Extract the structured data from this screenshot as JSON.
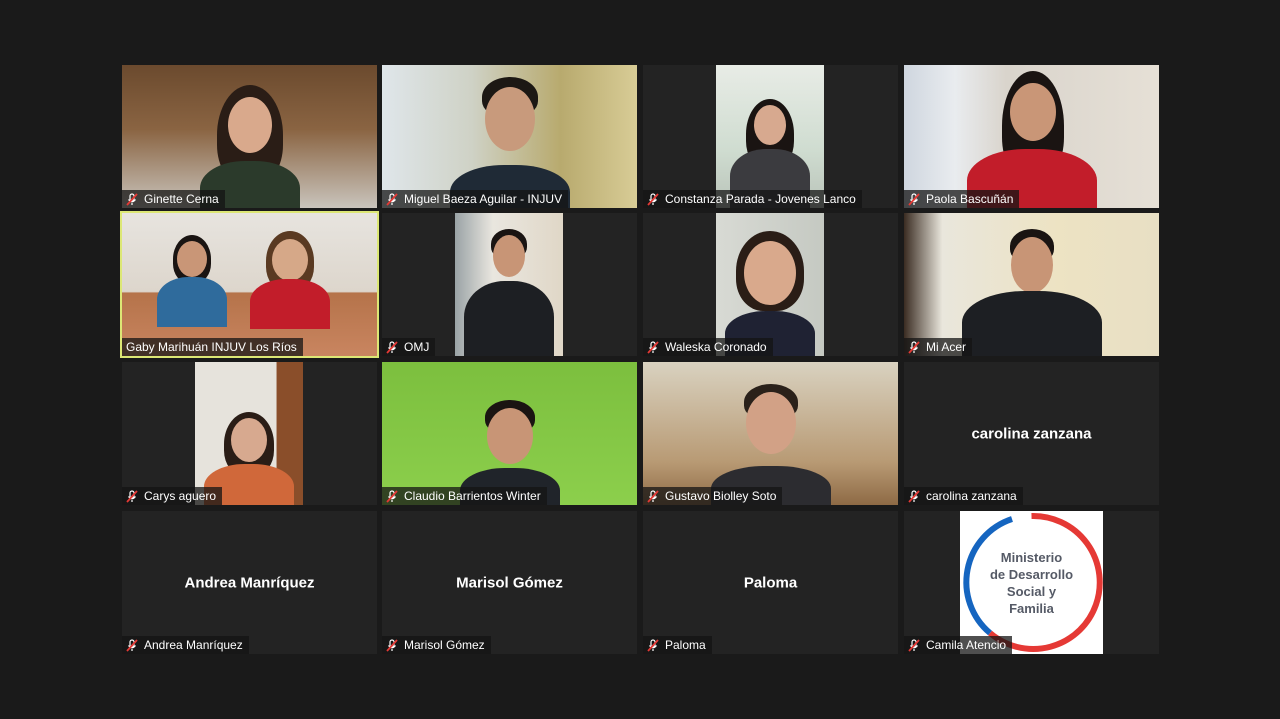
{
  "participants": [
    {
      "name": "Ginette Cerna",
      "muted": true
    },
    {
      "name": "Miguel Baeza Aguilar - INJUV",
      "muted": true
    },
    {
      "name": "Constanza Parada - Jovenes Lanco",
      "muted": true
    },
    {
      "name": "Paola Bascuñán",
      "muted": true
    },
    {
      "name": "Gaby Marihuán INJUV Los Ríos",
      "muted": false,
      "active_speaker": true
    },
    {
      "name": "OMJ",
      "muted": true
    },
    {
      "name": "Waleska Coronado",
      "muted": true
    },
    {
      "name": "Mi Acer",
      "muted": true
    },
    {
      "name": "Carys aguero",
      "muted": true
    },
    {
      "name": "Claudio Barrientos Winter",
      "muted": true
    },
    {
      "name": "Gustavo Biolley Soto",
      "muted": true
    },
    {
      "name": "carolina zanzana",
      "muted": true,
      "display_text": "carolina zanzana"
    },
    {
      "name": "Andrea Manríquez",
      "muted": true,
      "display_text": "Andrea Manríquez"
    },
    {
      "name": "Marisol Gómez",
      "muted": true,
      "display_text": "Marisol Gómez"
    },
    {
      "name": "Paloma",
      "muted": true,
      "display_text": "Paloma"
    },
    {
      "name": "Camila Atencio",
      "muted": true
    }
  ],
  "logo": {
    "line1": "Ministerio",
    "line2": "de Desarrollo",
    "line3": "Social y",
    "line4": "Familia"
  },
  "colors": {
    "background": "#1a1a1a",
    "tile": "#232323",
    "active_speaker_border": "#dce775",
    "muted_icon": "#e53935",
    "logo_blue": "#1565c0",
    "logo_red": "#e53935"
  }
}
